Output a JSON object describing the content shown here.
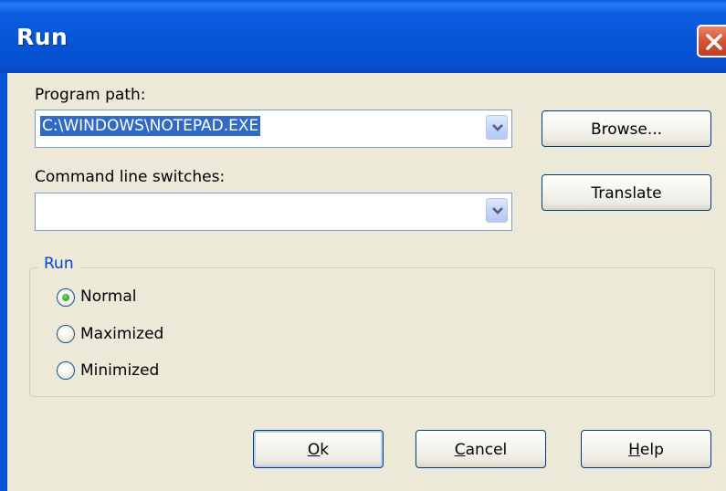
{
  "window": {
    "title": "Run"
  },
  "program_path": {
    "label": "Program path:",
    "value": "C:\\WINDOWS\\NOTEPAD.EXE"
  },
  "command_line": {
    "label": "Command line switches:",
    "value": ""
  },
  "buttons": {
    "browse": "Browse...",
    "translate": "Translate",
    "ok_underlined": "O",
    "ok_rest": "k",
    "cancel_underlined": "C",
    "cancel_rest": "ancel",
    "help_underlined": "H",
    "help_rest": "elp"
  },
  "run_group": {
    "title": "Run",
    "options": [
      {
        "label": "Normal",
        "selected": true
      },
      {
        "label": "Maximized",
        "selected": false
      },
      {
        "label": "Minimized",
        "selected": false
      }
    ]
  },
  "icons": {
    "close": "close-icon",
    "dropdown": "chevron-down-icon"
  },
  "colors": {
    "titlebar": "#0654d6",
    "close_button": "#d8553a",
    "selection": "#316ac5",
    "group_title": "#0046d5",
    "window_bg": "#ece9d8"
  }
}
